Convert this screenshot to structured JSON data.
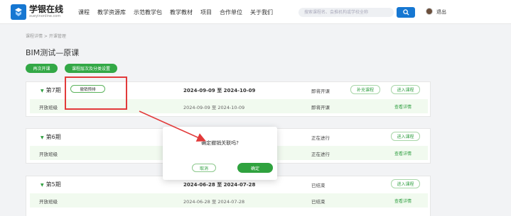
{
  "header": {
    "logo_title": "学银在线",
    "logo_subtitle": "xueyinonline.com",
    "nav": [
      "课程",
      "教学资源库",
      "示范教学包",
      "教学教材",
      "项目",
      "合作单位",
      "关于我们"
    ],
    "search_placeholder": "搜索课程名、会推机构或学校全称",
    "logout": "退出"
  },
  "breadcrumb": "课程详情 > 开课管理",
  "page_title": "BIM测试—原课",
  "actions": {
    "reopen": "再次开课",
    "settings": "课程层次及分类设置"
  },
  "terms": [
    {
      "period": "第7期",
      "cancel_schedule": "撤销预排",
      "dates": "2024-09-09 至 2024-10-09",
      "status": "即将开课",
      "edit_button": "补充课程",
      "enter_button": "进入课程",
      "class_label": "开放班级",
      "class_dates": "2024-09-09 至 2024-10-09",
      "class_status": "即将开课",
      "detail_link": "查看详情"
    },
    {
      "period": "第6期",
      "status": "正在进行",
      "enter_button": "进入课程",
      "class_label": "开放班级",
      "class_status": "正在进行",
      "detail_link": "查看详情"
    },
    {
      "period": "第5期",
      "dates": "2024-06-28 至 2024-07-28",
      "status": "已结束",
      "enter_button": "进入课程",
      "class_label": "开放班级",
      "class_dates": "2024-06-28 至 2024-07-28",
      "class_status": "已结束",
      "detail_link": "查看详情"
    }
  ],
  "dialog": {
    "message": "确定撤销关联吗?",
    "cancel": "取消",
    "confirm": "确定"
  },
  "colors": {
    "brand_blue": "#1677d2",
    "green": "#2fa23e",
    "annotation_red": "#e23a3a"
  }
}
